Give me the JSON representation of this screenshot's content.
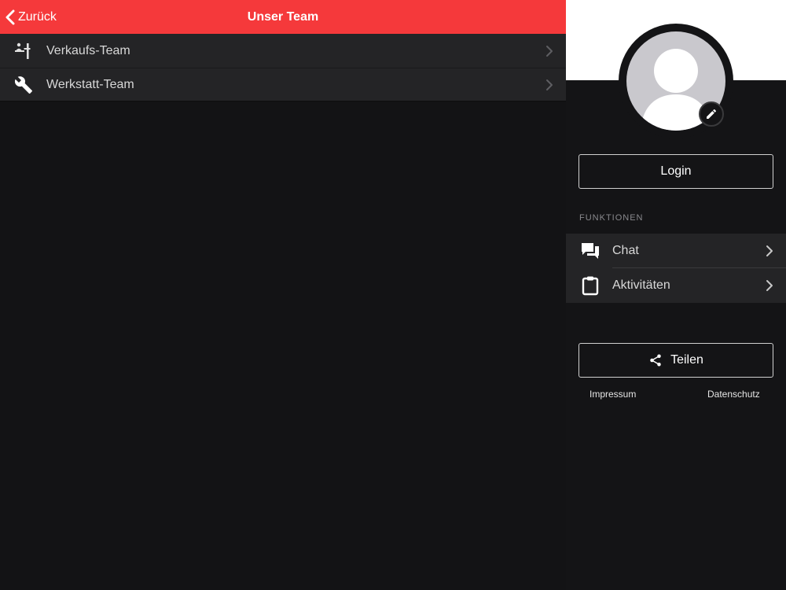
{
  "nav": {
    "back_label": "Zurück",
    "title": "Unser Team"
  },
  "teams": [
    {
      "label": "Verkaufs-Team",
      "icon": "sales-desk-icon"
    },
    {
      "label": "Werkstatt-Team",
      "icon": "wrench-icon"
    }
  ],
  "side": {
    "login_label": "Login",
    "section_label": "FUNKTIONEN",
    "functions": [
      {
        "label": "Chat",
        "icon": "chat-bubbles-icon"
      },
      {
        "label": "Aktivitäten",
        "icon": "clipboard-icon"
      }
    ],
    "share_label": "Teilen",
    "share_icon": "share-icon",
    "impressum_label": "Impressum",
    "datenschutz_label": "Datenschutz"
  },
  "colors": {
    "accent": "#f5393b",
    "background": "#131315",
    "row": "#242426"
  }
}
